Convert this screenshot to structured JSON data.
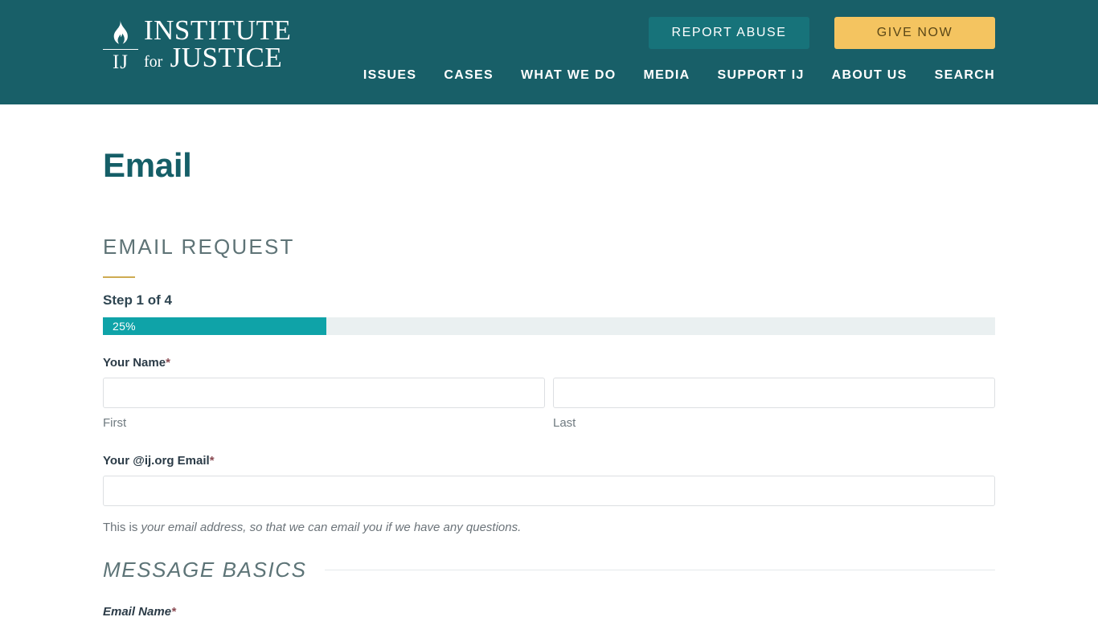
{
  "header": {
    "logo": {
      "icon": "flame-icon",
      "monogram": "IJ",
      "line1": "INSTITUTE",
      "for_word": "for",
      "line2": "JUSTICE",
      "alt": "Institute for Justice"
    },
    "buttons": {
      "report_abuse": "REPORT ABUSE",
      "give_now": "GIVE NOW"
    },
    "nav": [
      {
        "label": "ISSUES"
      },
      {
        "label": "CASES"
      },
      {
        "label": "WHAT WE DO"
      },
      {
        "label": "MEDIA"
      },
      {
        "label": "SUPPORT IJ"
      },
      {
        "label": "ABOUT US"
      },
      {
        "label": "SEARCH"
      }
    ],
    "colors": {
      "background": "#185f68",
      "report_abuse_bg": "#17737a",
      "give_now_bg": "#f4c460",
      "give_now_text": "#5a4717"
    }
  },
  "page": {
    "title": "Email"
  },
  "form": {
    "heading": "EMAIL REQUEST",
    "heading_rule_color": "#ceab52",
    "progress": {
      "step_label": "Step 1 of 4",
      "percent_label": "25%",
      "percent_value": 25,
      "fill_color": "#0fa3a8",
      "track_color": "#eaf0f1"
    },
    "fields": {
      "name": {
        "label": "Your Name",
        "required_marker": "*",
        "first": {
          "value": "",
          "placeholder": "",
          "sub_label": "First"
        },
        "last": {
          "value": "",
          "placeholder": "",
          "sub_label": "Last"
        }
      },
      "email": {
        "label": "Your @ij.org Email",
        "required_marker": "*",
        "value": "",
        "placeholder": "",
        "help_prefix": "This is ",
        "help_italic": "your email address, so that we can email you if we have any questions."
      }
    },
    "section": {
      "heading": "MESSAGE BASICS",
      "email_name": {
        "label": "Email Name",
        "required_marker": "*"
      }
    }
  }
}
